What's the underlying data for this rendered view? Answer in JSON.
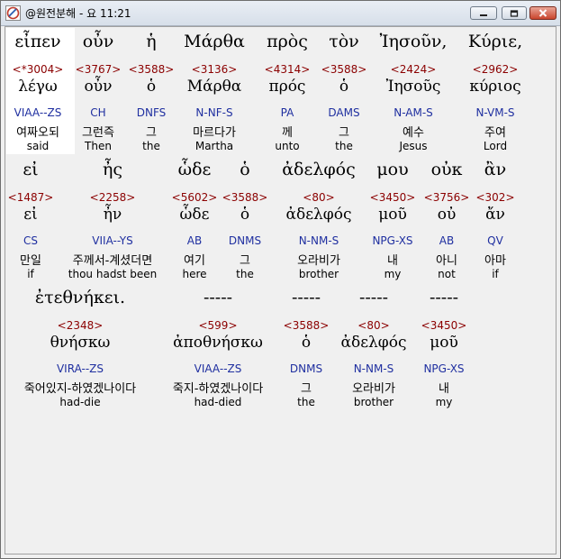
{
  "window": {
    "title": "@원전분해 - 요 11:21"
  },
  "rows": [
    {
      "cols": [
        {
          "greek": "εἶπεν",
          "num": "<*3004>",
          "lemma": "λέγω",
          "parse": "VIAA--ZS",
          "korean": "여짜오되",
          "english": "said"
        },
        {
          "greek": "οὖν",
          "num": "<3767>",
          "lemma": "οὖν",
          "parse": "CH",
          "korean": "그런즉",
          "english": "Then"
        },
        {
          "greek": "ἡ",
          "num": "<3588>",
          "lemma": "ὁ",
          "parse": "DNFS",
          "korean": "그",
          "english": "the"
        },
        {
          "greek": "Μάρθα",
          "num": "<3136>",
          "lemma": "Μάρθα",
          "parse": "N-NF-S",
          "korean": "마르다가",
          "english": "Martha"
        },
        {
          "greek": "πρὸς",
          "num": "<4314>",
          "lemma": "πρός",
          "parse": "PA",
          "korean": "께",
          "english": "unto"
        },
        {
          "greek": "τὸν",
          "num": "<3588>",
          "lemma": "ὁ",
          "parse": "DAMS",
          "korean": "그",
          "english": "the"
        },
        {
          "greek": "Ἰησοῦν,",
          "num": "<2424>",
          "lemma": "Ἰησοῦς",
          "parse": "N-AM-S",
          "korean": "예수",
          "english": "Jesus"
        },
        {
          "greek": "Κύριε,",
          "num": "<2962>",
          "lemma": "κύριος",
          "parse": "N-VM-S",
          "korean": "주여",
          "english": "Lord"
        }
      ]
    },
    {
      "cols": [
        {
          "greek": "εἰ",
          "num": "<1487>",
          "lemma": "εἰ",
          "parse": "CS",
          "korean": "만일",
          "english": "if"
        },
        {
          "greek": "ἦς",
          "num": "<2258>",
          "lemma": "ἦν",
          "parse": "VIIA--YS",
          "korean": "주께서-계셨더면",
          "english": "thou hadst been"
        },
        {
          "greek": "ὧδε",
          "num": "<5602>",
          "lemma": "ὧδε",
          "parse": "AB",
          "korean": "여기",
          "english": "here"
        },
        {
          "greek": "ὁ",
          "num": "<3588>",
          "lemma": "ὁ",
          "parse": "DNMS",
          "korean": "그",
          "english": "the"
        },
        {
          "greek": "ἀδελφός",
          "num": "<80>",
          "lemma": "ἀδελφός",
          "parse": "N-NM-S",
          "korean": "오라비가",
          "english": "brother"
        },
        {
          "greek": "μου",
          "num": "<3450>",
          "lemma": "μοῦ",
          "parse": "NPG-XS",
          "korean": "내",
          "english": "my"
        },
        {
          "greek": "οὐκ",
          "num": "<3756>",
          "lemma": "οὐ",
          "parse": "AB",
          "korean": "아니",
          "english": "not"
        },
        {
          "greek": "ἂν",
          "num": "<302>",
          "lemma": "ἄν",
          "parse": "QV",
          "korean": "아마",
          "english": "if"
        }
      ]
    },
    {
      "cols": [
        {
          "greek": "ἐτεθνήκει.",
          "num": "<2348>",
          "lemma": "θνήσκω",
          "parse": "VIRA--ZS",
          "korean": "죽어있지-하였겠나이다",
          "english": "had-die"
        },
        {
          "greek": "-----",
          "num": "<599>",
          "lemma": "ἀποθνήσκω",
          "parse": "VIAA--ZS",
          "korean": "죽지-하였겠나이다",
          "english": "had-died"
        },
        {
          "greek": "-----",
          "num": "<3588>",
          "lemma": "ὁ",
          "parse": "DNMS",
          "korean": "그",
          "english": "the"
        },
        {
          "greek": "-----",
          "num": "<80>",
          "lemma": "ἀδελφός",
          "parse": "N-NM-S",
          "korean": "오라비가",
          "english": "brother"
        },
        {
          "greek": "-----",
          "num": "<3450>",
          "lemma": "μοῦ",
          "parse": "NPG-XS",
          "korean": "내",
          "english": "my"
        }
      ]
    }
  ]
}
